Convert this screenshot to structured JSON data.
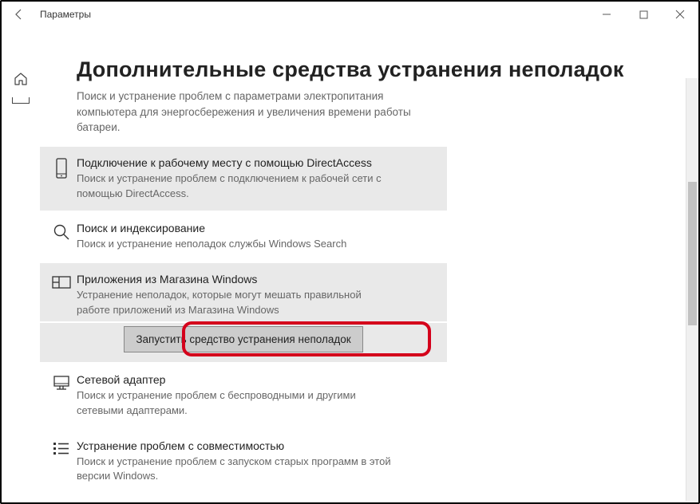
{
  "window": {
    "title": "Параметры"
  },
  "page": {
    "heading": "Дополнительные средства устранения неполадок",
    "sublead": "Поиск и устранение проблем с параметрами электропитания компьютера для энергосбережения и увеличения  времени работы батареи."
  },
  "items": {
    "directaccess": {
      "title": "Подключение к рабочему месту с помощью DirectAccess",
      "desc": "Поиск и устранение проблем с подключением к рабочей сети с помощью DirectAccess."
    },
    "search": {
      "title": "Поиск и индексирование",
      "desc": "Поиск и устранение неполадок службы Windows Search"
    },
    "store": {
      "title": "Приложения из Магазина Windows",
      "desc": "Устранение неполадок, которые могут мешать правильной работе приложений из Магазина Windows"
    },
    "network": {
      "title": "Сетевой адаптер",
      "desc": "Поиск и устранение проблем с беспроводными и другими сетевыми адаптерами."
    },
    "compat": {
      "title": "Устранение проблем с совместимостью",
      "desc": "Поиск и устранение проблем с запуском старых программ в этой версии Windows."
    }
  },
  "run_button": "Запустить средство устранения неполадок"
}
